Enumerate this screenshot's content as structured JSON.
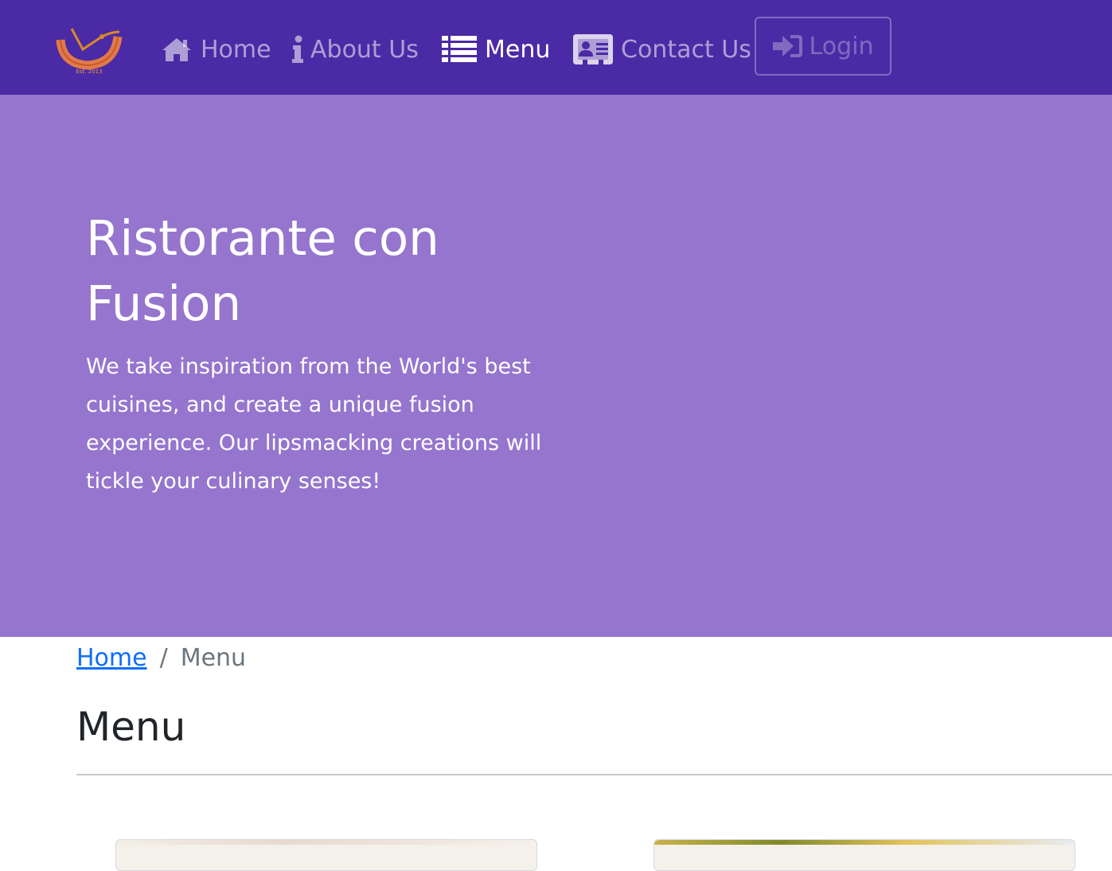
{
  "navbar": {
    "logo": {
      "text": "Ristorante con Fusion",
      "est": "Est. 2013"
    },
    "items": [
      {
        "label": "Home",
        "icon": "home-icon",
        "active": false
      },
      {
        "label": "About Us",
        "icon": "info-icon",
        "active": false
      },
      {
        "label": "Menu",
        "icon": "list-icon",
        "active": true
      },
      {
        "label": "Contact Us",
        "icon": "address-card-icon",
        "active": false
      }
    ],
    "login": {
      "label": "Login",
      "icon": "sign-in-icon"
    }
  },
  "hero": {
    "title": "Ristorante con Fusion",
    "text": "We take inspiration from the World's best cuisines, and create a unique fusion experience. Our lipsmacking creations will tickle your culinary senses!"
  },
  "breadcrumb": {
    "home": "Home",
    "separator": "/",
    "current": "Menu"
  },
  "section": {
    "title": "Menu"
  },
  "colors": {
    "navbar": "#4b2aa5",
    "hero": "#9575cd",
    "link": "#0d6efd"
  }
}
